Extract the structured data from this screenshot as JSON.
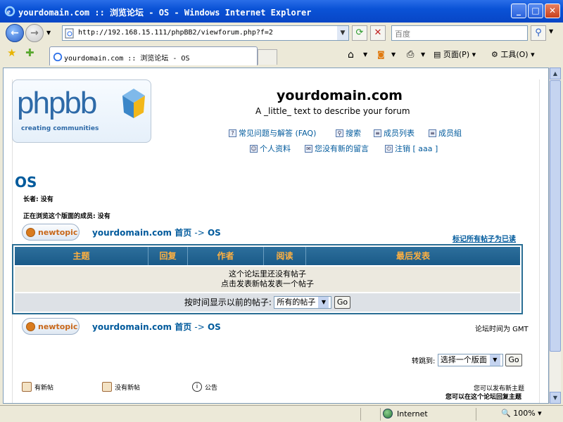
{
  "window": {
    "title": "yourdomain.com :: 浏览论坛 - OS - Windows Internet Explorer"
  },
  "address": {
    "url": "http://192.168.15.111/phpBB2/viewforum.php?f=2"
  },
  "search": {
    "placeholder": "百度"
  },
  "tab": {
    "title": "yourdomain.com :: 浏览论坛 - OS"
  },
  "commands": {
    "page": "页面(P)",
    "tools": "工具(O)"
  },
  "site": {
    "name": "yourdomain.com",
    "description": "A _little_ text to describe your forum",
    "logo_text": "phpbb",
    "logo_tagline": "creating communities"
  },
  "nav": {
    "faq": "常见问题与解答 (FAQ)",
    "search": "搜索",
    "memberlist": "成员列表",
    "groups": "成员組",
    "profile": "个人资料",
    "messages": "您没有新的留言",
    "logout": "注销 [ aaa ]"
  },
  "forum": {
    "title": "OS",
    "moderator": "长者: 没有",
    "browsing": "正在浏览这个版面的成员: 没有",
    "breadcrumb_home": "yourdomain.com 首页",
    "breadcrumb_sep": "->",
    "breadcrumb_forum": "OS",
    "mark_read": "标记所有帖子为已读",
    "timezone": "论坛时间为 GMT",
    "newtopic_label": "newtopic"
  },
  "table": {
    "headers": [
      "主题",
      "回复",
      "作者",
      "阅读",
      "最后发表"
    ],
    "empty_line1": "这个论坛里还没有帖子",
    "empty_line2": "点击发表新帖发表一个帖子",
    "filter_label": "按时间显示以前的帖子:",
    "filter_value": "所有的帖子",
    "go": "Go"
  },
  "jump": {
    "label": "转跳到:",
    "value": "选择一个版面",
    "go": "Go"
  },
  "legend": {
    "new_posts": "有新帖",
    "no_new_posts": "没有新帖",
    "announcement": "公告",
    "can_post": "您可以发布新主题",
    "can_reply": "您可以在这个论坛回复主题"
  },
  "status": {
    "zone": "Internet",
    "zoom": "100%"
  }
}
